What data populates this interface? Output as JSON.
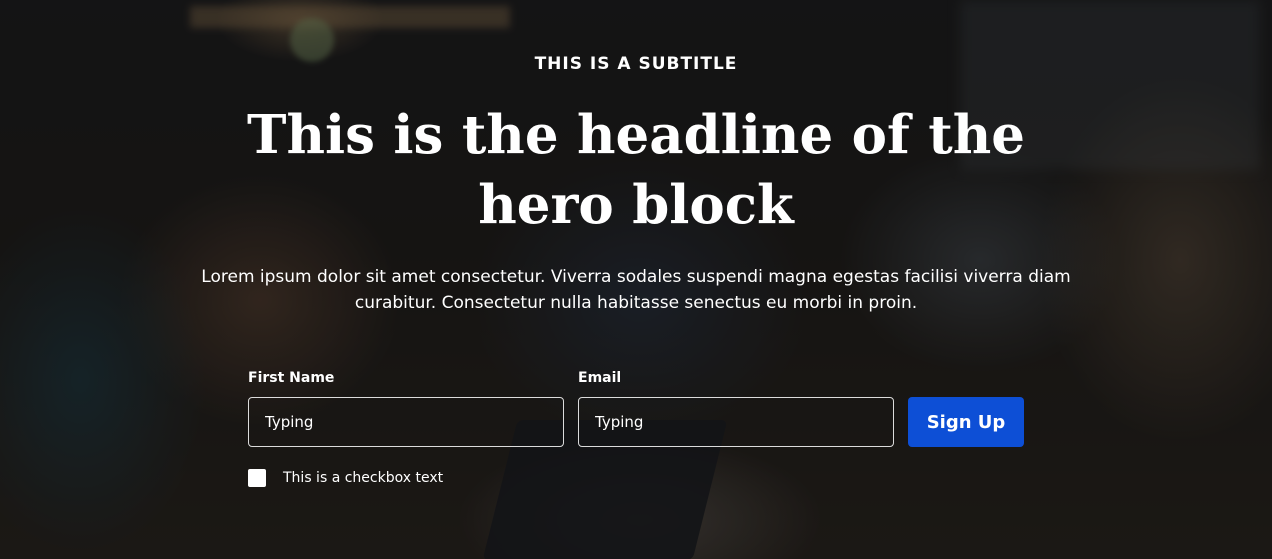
{
  "hero": {
    "subtitle": "THIS IS A SUBTITLE",
    "headline": "This is the headline of the hero block",
    "description": "Lorem ipsum dolor sit amet consectetur. Viverra sodales suspendi magna egestas facilisi viverra diam curabitur. Consectetur nulla habitasse senectus eu morbi in proin."
  },
  "form": {
    "first_name": {
      "label": "First Name",
      "value": "Typing"
    },
    "email": {
      "label": "Email",
      "value": "Typing"
    },
    "submit_label": "Sign Up",
    "checkbox": {
      "label": "This is a checkbox text",
      "checked": false
    }
  },
  "colors": {
    "button": "#0d4fd6",
    "text": "#ffffff",
    "overlay": "rgba(0,0,0,0.52)"
  }
}
